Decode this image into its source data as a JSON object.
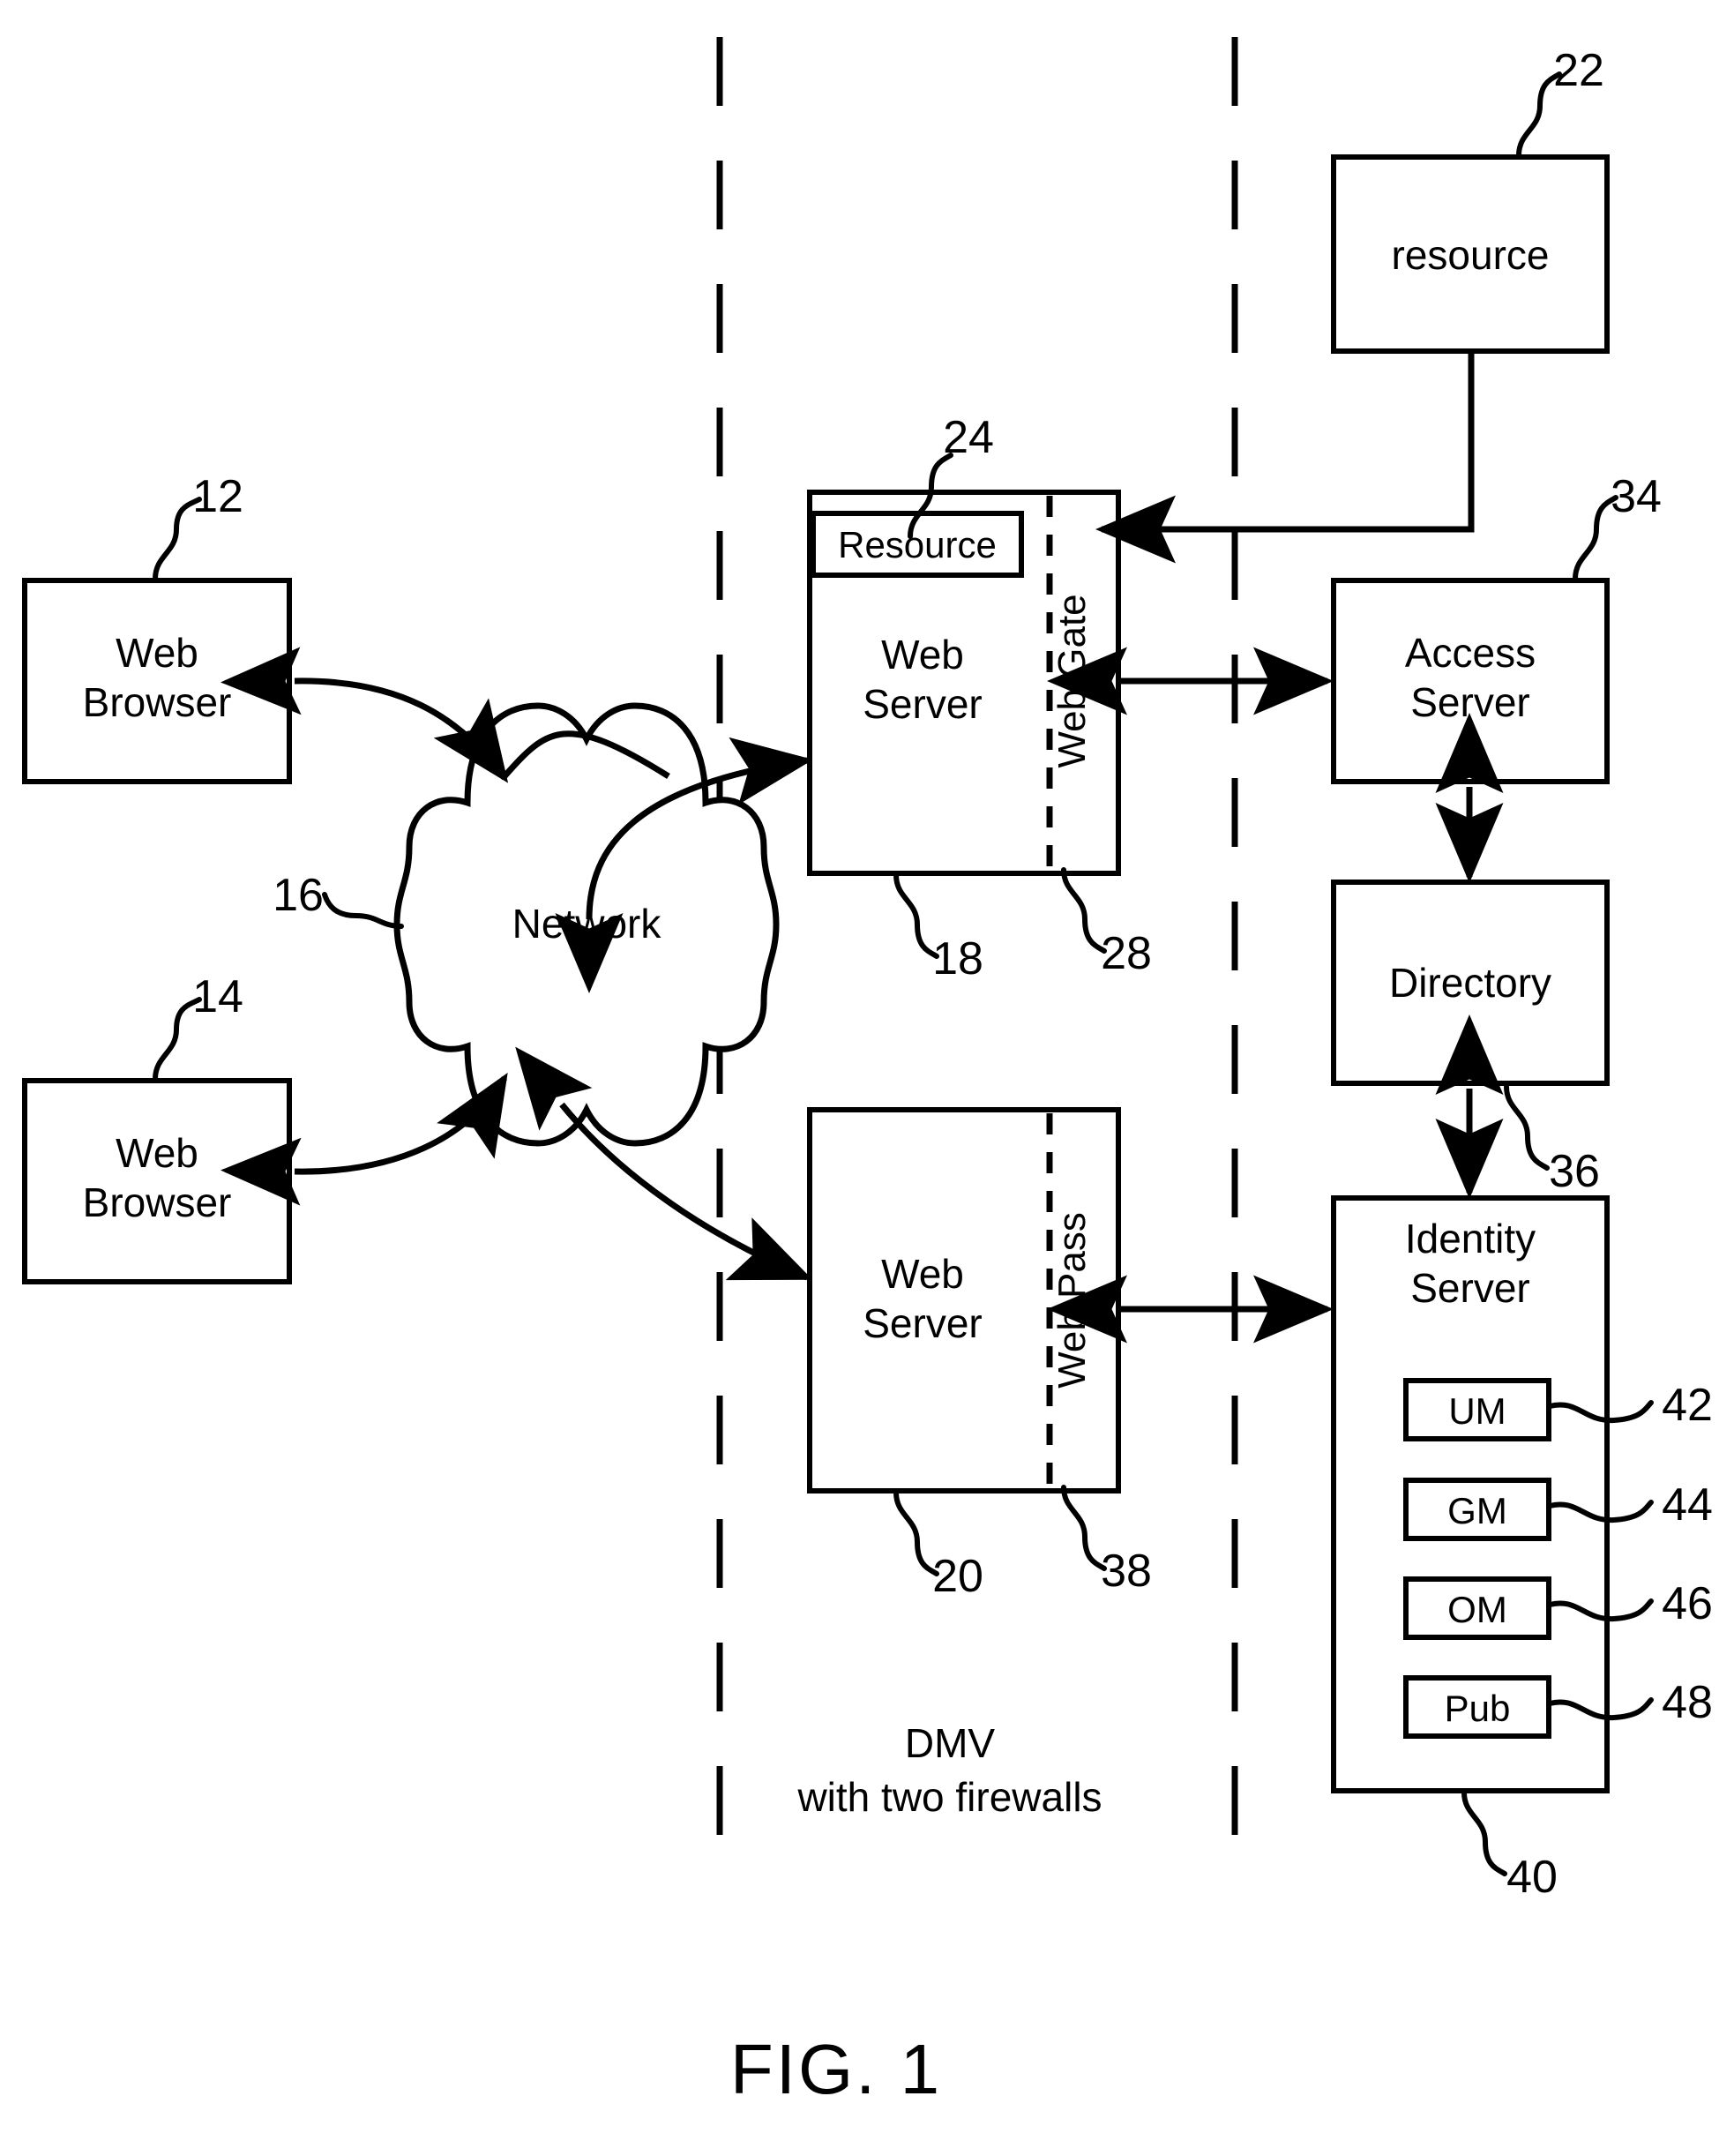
{
  "figure": {
    "caption": "FIG. 1"
  },
  "zone_label": {
    "line1": "DMV",
    "line2": "with  two firewalls"
  },
  "nodes": {
    "web_browser_top": {
      "line1": "Web",
      "line2": "Browser",
      "ref": "12"
    },
    "web_browser_bottom": {
      "line1": "Web",
      "line2": "Browser",
      "ref": "14"
    },
    "network": {
      "label": "Network",
      "ref": "16"
    },
    "web_server_top": {
      "line1": "Web",
      "line2": "Server",
      "ref": "18"
    },
    "web_gate": {
      "label": "Web Gate",
      "ref": "28"
    },
    "resource_inner": {
      "label": "Resource",
      "ref": "24"
    },
    "resource_external": {
      "label": "resource",
      "ref": "22"
    },
    "web_server_bottom": {
      "line1": "Web",
      "line2": "Server",
      "ref": "20"
    },
    "web_pass": {
      "label": "Web Pass",
      "ref": "38"
    },
    "access_server": {
      "line1": "Access",
      "line2": "Server",
      "ref": "34"
    },
    "directory": {
      "label": "Directory",
      "ref": "36"
    },
    "identity_server": {
      "line1": "Identity",
      "line2": "Server",
      "ref": "40"
    },
    "um": {
      "label": "UM",
      "ref": "42"
    },
    "gm": {
      "label": "GM",
      "ref": "44"
    },
    "om": {
      "label": "OM",
      "ref": "46"
    },
    "pub": {
      "label": "Pub",
      "ref": "48"
    }
  },
  "colors": {
    "ink": "#000000",
    "paper": "#ffffff"
  }
}
